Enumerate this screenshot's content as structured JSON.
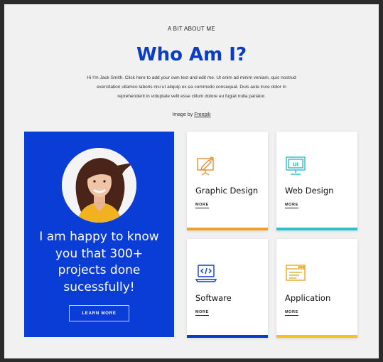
{
  "eyebrow": "A BIT ABOUT ME",
  "title": "Who Am I?",
  "intro_lines": [
    "Hi I'm Jack Smith. Click here to add your own text and edit me. Ut enim ad minim veniam, quis nostrud",
    "exercitation ullamco laboris nisi ut aliquip ex ea commodo consequat. Duis aute irure dolor in",
    "reprehenderit in voluptate velit esse cillum dolore eu fugiat nulla pariatur."
  ],
  "credit": {
    "prefix": "Image by ",
    "link": "Freepik"
  },
  "hero": {
    "lines": [
      "I am happy to know",
      "you that 300+",
      "projects done",
      "sucessfully!"
    ],
    "button": "LEARN MORE"
  },
  "cards": [
    {
      "title": "Graphic Design",
      "more": "MORE",
      "icon": "easel-icon",
      "color": "#f0a12a"
    },
    {
      "title": "Web Design",
      "more": "MORE",
      "icon": "ui-monitor-icon",
      "color": "#27c3cc"
    },
    {
      "title": "Software",
      "more": "MORE",
      "icon": "code-laptop-icon",
      "color": "#0a3cc7"
    },
    {
      "title": "Application",
      "more": "MORE",
      "icon": "app-window-icon",
      "color": "#f3c41d"
    }
  ],
  "colors": {
    "accent": "#0a3cc7",
    "hero_bg": "#0a3cd6",
    "page_bg": "#f1f1f1"
  }
}
